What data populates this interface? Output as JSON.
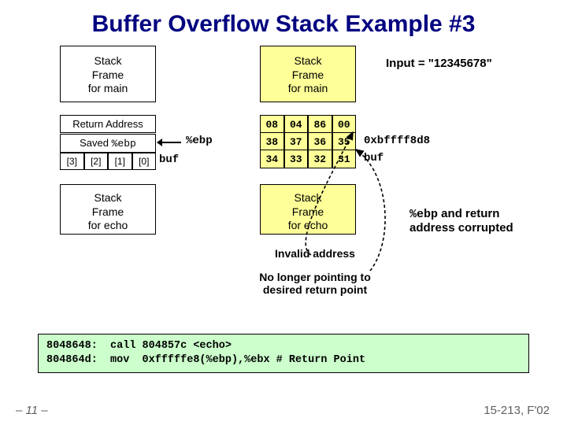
{
  "title": "Buffer Overflow Stack Example #3",
  "left_stack": {
    "main": "Stack\nFrame\nfor main",
    "return_addr": "Return Address",
    "saved_ebp": "Saved %ebp",
    "buf_cells": [
      "[3]",
      "[2]",
      "[1]",
      "[0]"
    ],
    "echo": "Stack\nFrame\nfor echo"
  },
  "ebp_label": "%ebp",
  "buf_label_l": "buf",
  "right_stack": {
    "main": "Stack\nFrame\nfor main",
    "row1": [
      "08",
      "04",
      "86",
      "00"
    ],
    "row2": [
      "38",
      "37",
      "36",
      "35"
    ],
    "row3": [
      "34",
      "33",
      "32",
      "31"
    ],
    "echo": "Stack\nFrame\nfor echo"
  },
  "right_labels": {
    "row2": "0xbffff8d8",
    "row3": "buf"
  },
  "input_label": "Input = \"12345678\"",
  "note_right": "%ebp and return\naddress corrupted",
  "caption_invalid": "Invalid address",
  "caption_nolonger": "No longer pointing to\ndesired return point",
  "code_line1": "8048648:  call 804857c <echo>",
  "code_line2": "804864d:  mov  0xfffffe8(%ebp),%ebx # Return Point",
  "footer_left": "– 11 –",
  "footer_right": "15-213, F'02"
}
